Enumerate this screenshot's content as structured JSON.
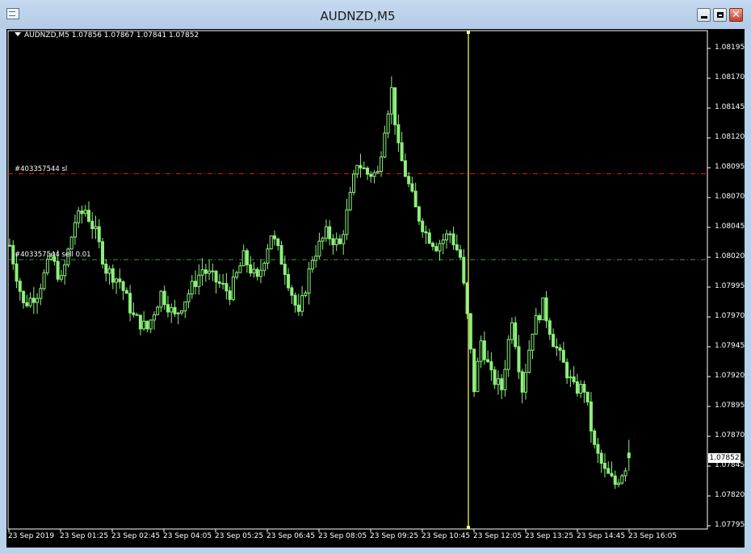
{
  "window": {
    "title": "AUDNZD,M5",
    "minimize_glyph": "minimize-icon",
    "maximize_glyph": "maximize-icon",
    "close_glyph": "close-icon"
  },
  "chart": {
    "info_text": "AUDNZD,M5  1.07856 1.07867 1.07841 1.07852",
    "sl_label": "#403357544 sl",
    "order_label": "#403357544 sell 0.01",
    "current_price": "1.07852",
    "colors": {
      "background": "#000000",
      "bull": "#8cf07a",
      "sl_line": "#e02020",
      "order_line": "#3a9a3a",
      "crosshair": "#ffff66",
      "axis_text": "#ffffff"
    }
  },
  "chart_data": {
    "type": "candlestick",
    "symbol": "AUDNZD",
    "timeframe": "M5",
    "y_axis_ticks": [
      "1.08195",
      "1.08170",
      "1.08145",
      "1.08120",
      "1.08095",
      "1.08070",
      "1.08045",
      "1.08020",
      "1.07995",
      "1.07970",
      "1.07945",
      "1.07920",
      "1.07895",
      "1.07870",
      "1.07845",
      "1.07820",
      "1.07795"
    ],
    "x_axis_ticks": [
      "23 Sep 2019",
      "23 Sep 01:25",
      "23 Sep 02:45",
      "23 Sep 04:05",
      "23 Sep 05:25",
      "23 Sep 06:45",
      "23 Sep 08:05",
      "23 Sep 09:25",
      "23 Sep 10:45",
      "23 Sep 12:05",
      "23 Sep 13:25",
      "23 Sep 14:45",
      "23 Sep 16:05"
    ],
    "ylim": [
      1.07795,
      1.08205
    ],
    "sl_price": 1.0809,
    "order_price": 1.08018,
    "last_bar": {
      "open": 1.07856,
      "high": 1.07867,
      "low": 1.07841,
      "close": 1.07852
    },
    "close_path": [
      [
        0,
        1.0803
      ],
      [
        4,
        1.0798
      ],
      [
        8,
        1.0799
      ],
      [
        12,
        1.0802
      ],
      [
        15,
        1.08
      ],
      [
        19,
        1.0805
      ],
      [
        22,
        1.0806
      ],
      [
        25,
        1.0804
      ],
      [
        28,
        1.0801
      ],
      [
        32,
        1.08
      ],
      [
        36,
        1.0797
      ],
      [
        40,
        1.0796
      ],
      [
        44,
        1.0799
      ],
      [
        48,
        1.0797
      ],
      [
        52,
        1.0799
      ],
      [
        56,
        1.0801
      ],
      [
        60,
        1.08
      ],
      [
        64,
        1.0799
      ],
      [
        68,
        1.0802
      ],
      [
        72,
        1.08
      ],
      [
        76,
        1.0804
      ],
      [
        80,
        1.0801
      ],
      [
        84,
        1.0797
      ],
      [
        88,
        1.0802
      ],
      [
        92,
        1.0804
      ],
      [
        96,
        1.0803
      ],
      [
        99,
        1.0807
      ],
      [
        101,
        1.081
      ],
      [
        104,
        1.0809
      ],
      [
        107,
        1.0809
      ],
      [
        109,
        1.0813
      ],
      [
        111,
        1.0816
      ],
      [
        113,
        1.0811
      ],
      [
        115,
        1.0809
      ],
      [
        118,
        1.0806
      ],
      [
        121,
        1.0804
      ],
      [
        124,
        1.0803
      ],
      [
        128,
        1.0804
      ],
      [
        131,
        1.0802
      ],
      [
        133,
        1.0797
      ],
      [
        135,
        1.0791
      ],
      [
        137,
        1.0795
      ],
      [
        140,
        1.0792
      ],
      [
        143,
        1.0791
      ],
      [
        146,
        1.0797
      ],
      [
        149,
        1.0791
      ],
      [
        152,
        1.0796
      ],
      [
        155,
        1.0798
      ],
      [
        158,
        1.0795
      ],
      [
        161,
        1.0793
      ],
      [
        164,
        1.0791
      ],
      [
        167,
        1.0791
      ],
      [
        170,
        1.0786
      ],
      [
        173,
        1.0784
      ],
      [
        176,
        1.0783
      ],
      [
        178,
        1.0784
      ],
      [
        180,
        1.0785
      ]
    ]
  }
}
